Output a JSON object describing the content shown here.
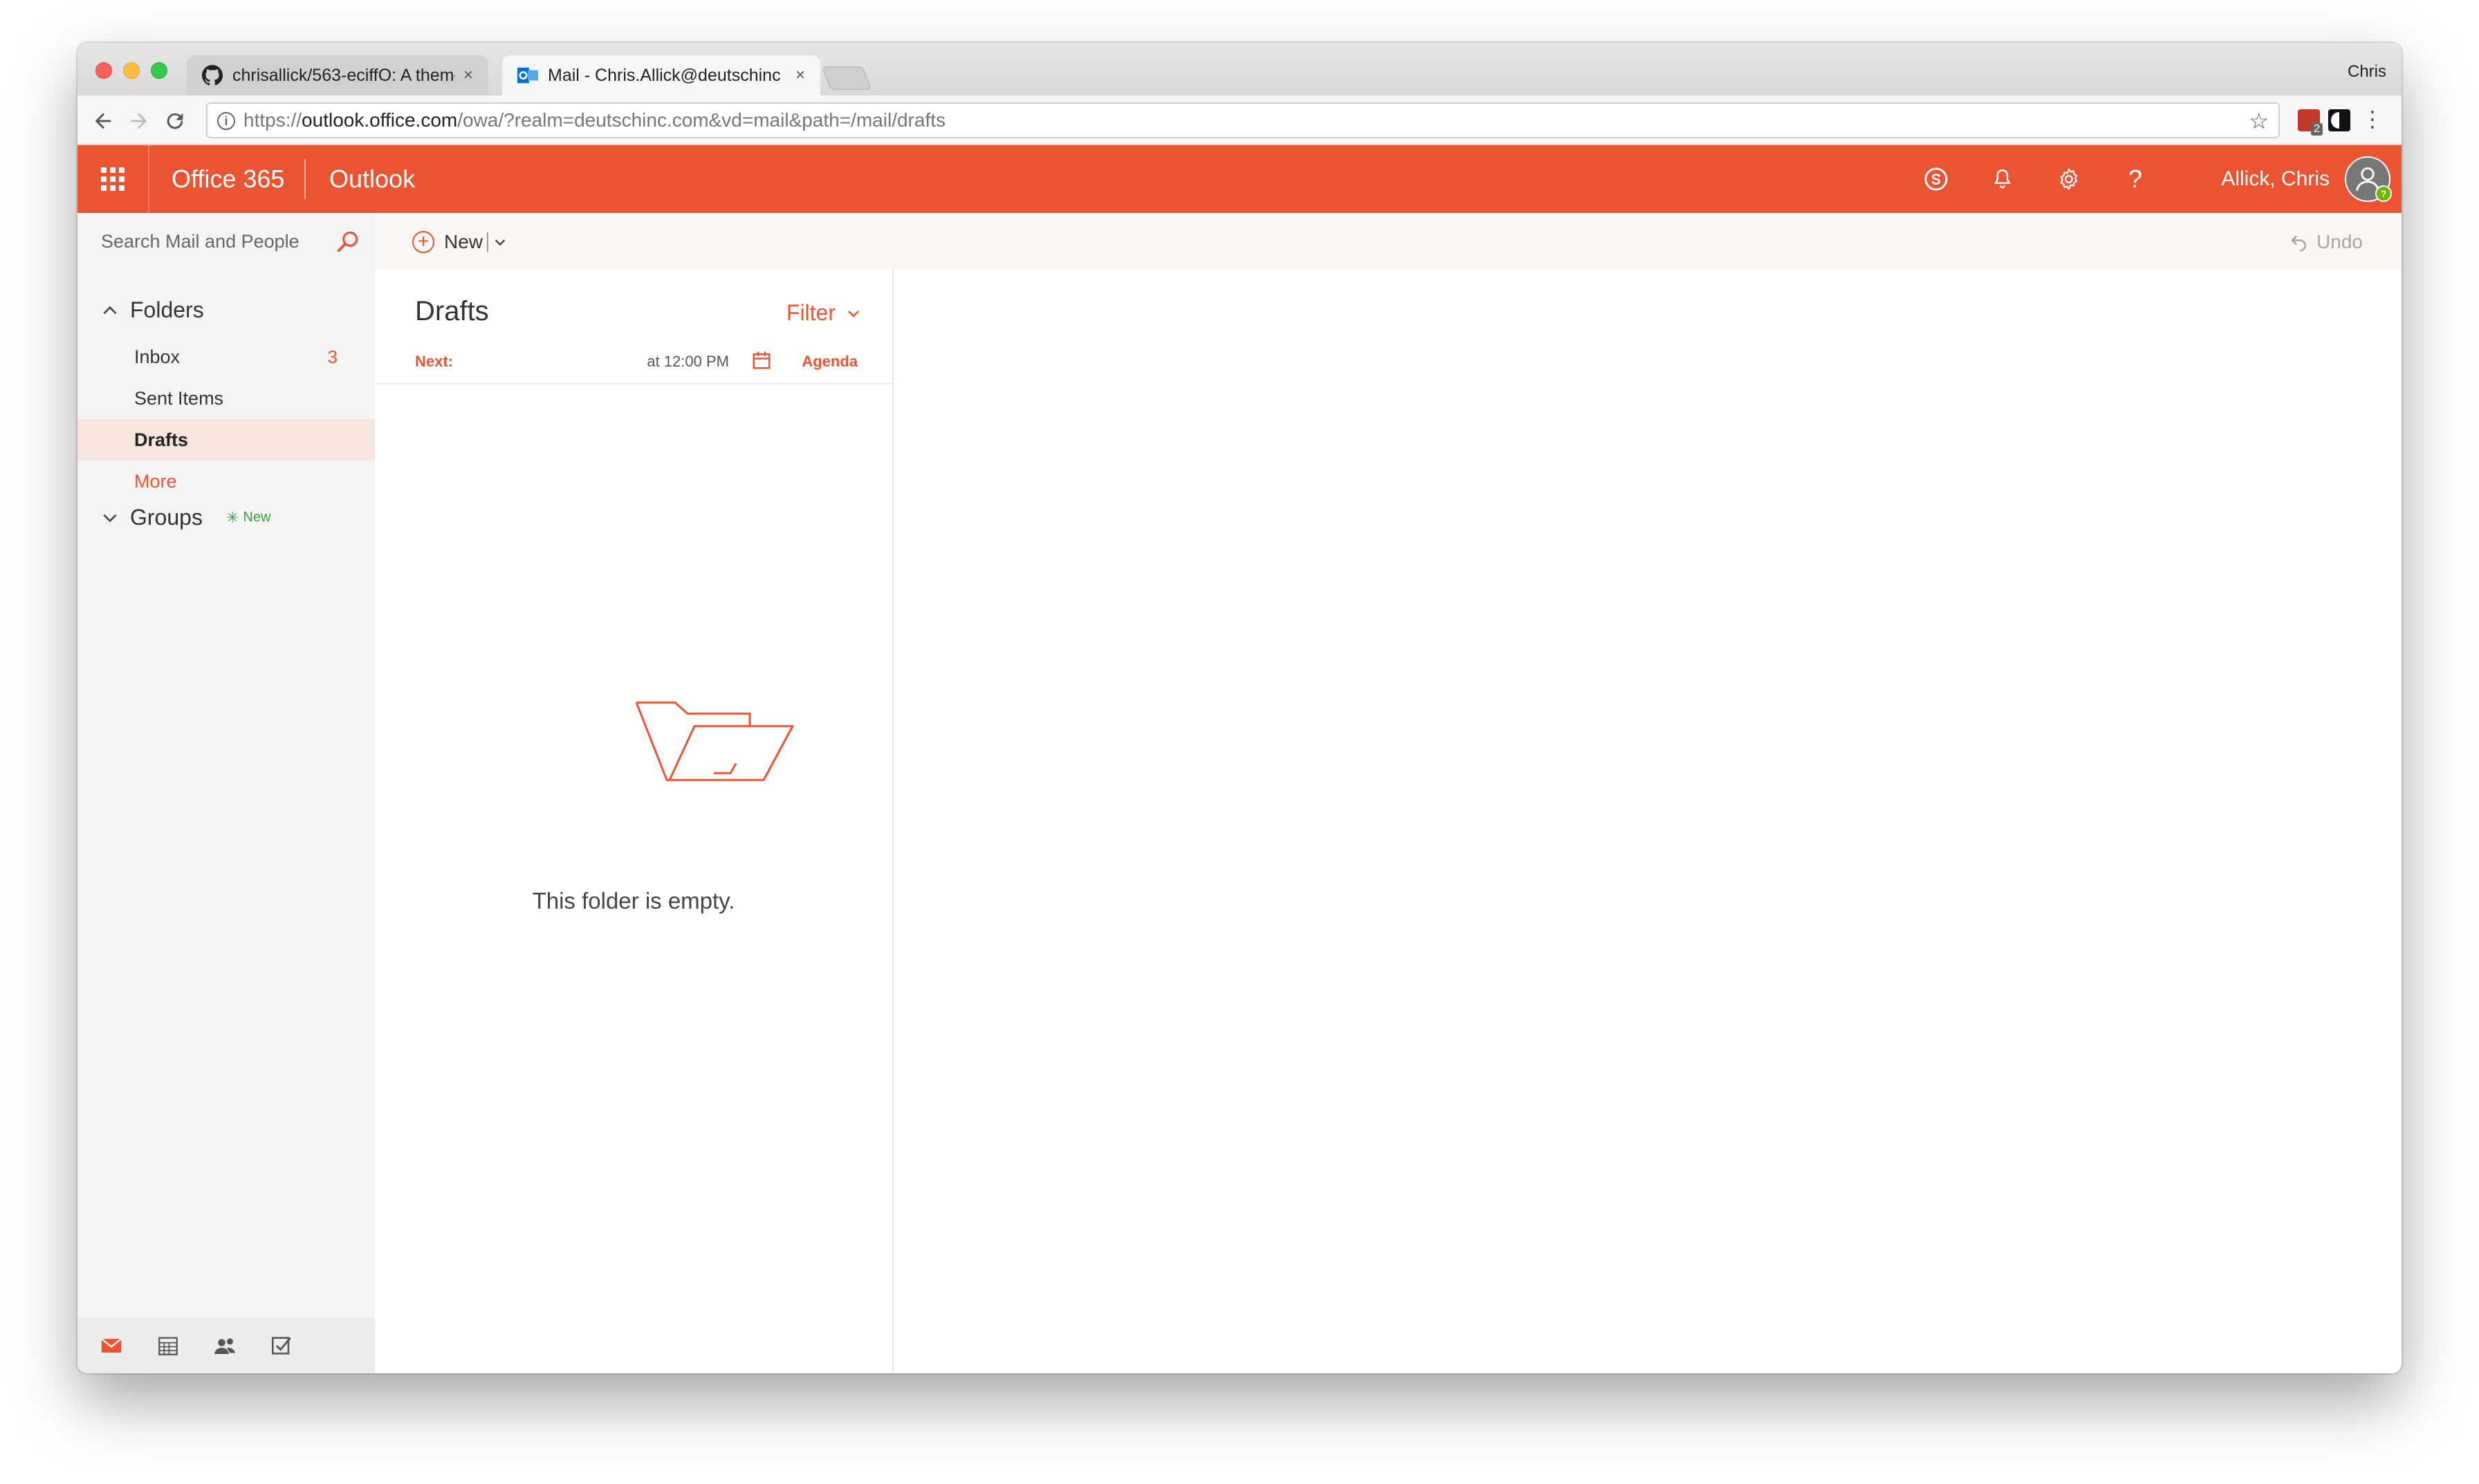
{
  "browser": {
    "tabs": [
      {
        "title": "chrisallick/563-eciffO: A theme",
        "close": "×"
      },
      {
        "title": "Mail - Chris.Allick@deutschinc",
        "close": "×"
      }
    ],
    "profile": "Chris",
    "url_prefix": "https://",
    "url_host": "outlook.office.com",
    "url_path": "/owa/?realm=deutschinc.com&vd=mail&path=/mail/drafts",
    "info_glyph": "i",
    "ext_badge": "2"
  },
  "header": {
    "suite": "Office 365",
    "app": "Outlook",
    "user": "Allick, Chris",
    "help": "?",
    "presence": "?"
  },
  "commands": {
    "search_placeholder": "Search Mail and People",
    "new_label": "New",
    "undo_label": "Undo"
  },
  "nav": {
    "folders_label": "Folders",
    "items": [
      {
        "label": "Inbox",
        "count": "3"
      },
      {
        "label": "Sent Items",
        "count": ""
      },
      {
        "label": "Drafts",
        "count": ""
      }
    ],
    "more_label": "More",
    "groups_label": "Groups",
    "groups_badge": "New"
  },
  "list": {
    "title": "Drafts",
    "filter_label": "Filter",
    "next_label": "Next:",
    "next_time": "at 12:00 PM",
    "agenda_label": "Agenda",
    "empty_message": "This folder is empty."
  },
  "colors": {
    "accent": "#ea5432",
    "selected_bg": "#f6e4df",
    "nav_bg": "#f4f4f4"
  }
}
